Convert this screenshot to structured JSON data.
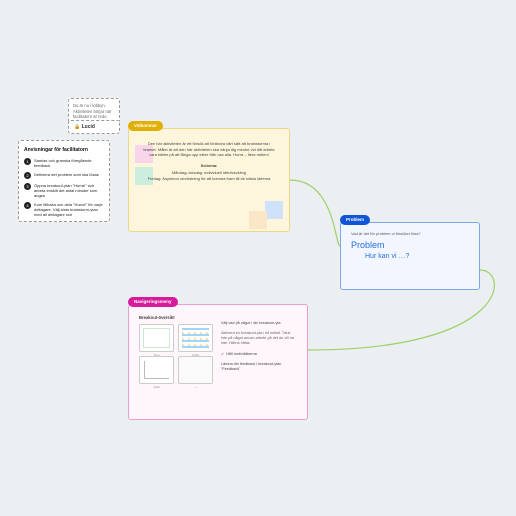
{
  "topsmall": {
    "text": "Du är nu i lobbyn. Aktiviteten börjar när facilitatorn är redo."
  },
  "lucid": {
    "label": "🔒 Lucid"
  },
  "instructions": {
    "title": "Anvisningar för facilitatorn",
    "steps": [
      "Samlas och granska föregående feedback",
      "Definiera det problem som ska lösas",
      "Öppna breakout-ytan \"Hurra!\" och arbeta enskilt det antal minuter som anges",
      "Kom tillbaka och dela \"Hurra!\" för varje deltagare. Välj sista brainstorm-ytan med all deltagare och"
    ]
  },
  "welcome": {
    "tag": "Välkomna!",
    "body": "Den här aktiviteten är ett försök att förändra vårt sätt att brainstorma i teamet. Målet är att den här aktiviteten ska vänja dig mindre vid ditt arbete vara bättre på att fånga upp idéer från oss alla. Hurra – flera möten!",
    "scheduleLabel": "Schema:",
    "schedule1": "Måndag–torsdag: individuell idéutveckling",
    "schedule2": "Fredag: Asynkron omröstning för att komma fram till de bästa idéerna"
  },
  "problem": {
    "tag": "Problem",
    "q": "Vad är det för problem vi försöker lösa?",
    "title": "Problem",
    "subtitle": "Hur kan vi …?"
  },
  "brainstorm": {
    "tag": "Navigeringsmeny",
    "thumbsTitle": "Breakout-översikt",
    "thumbs": [
      "Tom",
      "Fylld",
      "Graf",
      "—"
    ],
    "line1": "Välj vad på något i din breakout-yta",
    "line2": "Aktivera en breakout-yta i tid initialt. Tänk inte på något annan arbete på det du vill ha inte. Hårna hittas",
    "line3": "Håll motiviklikerna",
    "line4": "Lämna din feedback i breakout-ytan \"Feedback\""
  }
}
